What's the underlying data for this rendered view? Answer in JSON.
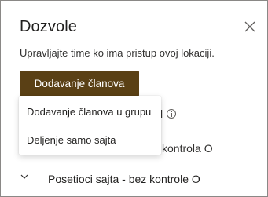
{
  "panel": {
    "title": "Dozvole",
    "description": "Upravljajte time ko ima pristup ovoj lokaciji.",
    "add_button_label": "Dodavanje članova",
    "close_icon": "close-icon"
  },
  "dropdown": {
    "items": [
      {
        "label": "Dodavanje članova u grupu"
      },
      {
        "label": "Deljenje samo sajta"
      }
    ]
  },
  "groups": {
    "partial_row_1": "l",
    "partial_row_2": "kontrola O",
    "visitors_label": "Posetioci sajta - bez kontrole O"
  },
  "colors": {
    "accent": "#5a4015",
    "text": "#323130",
    "border": "#8a8886"
  }
}
